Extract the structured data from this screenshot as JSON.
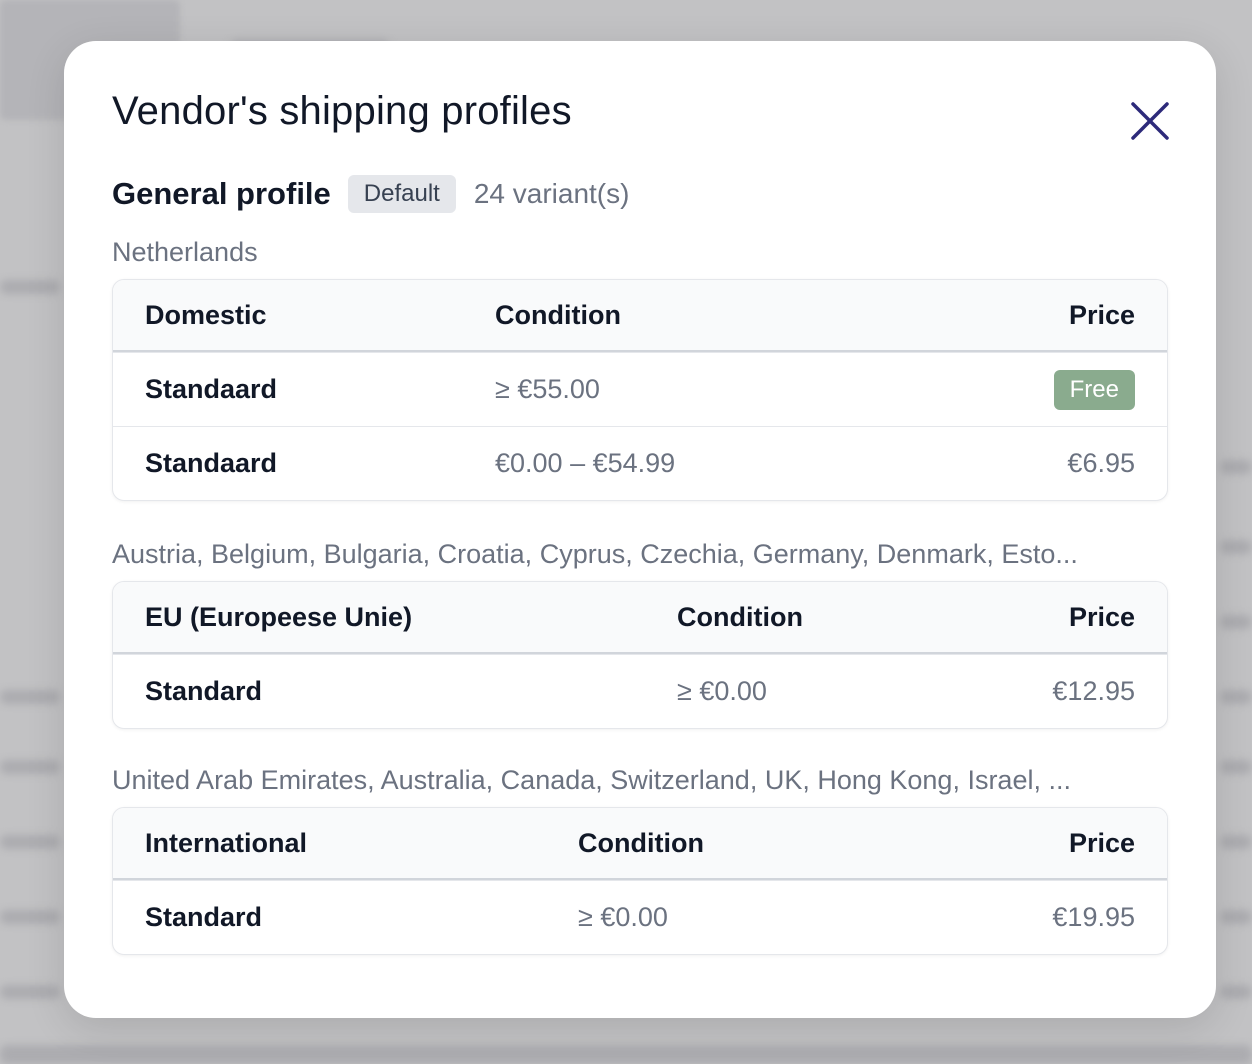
{
  "modal": {
    "title": "Vendor's shipping profiles",
    "close_icon": "close-icon"
  },
  "profile": {
    "name": "General profile",
    "badge": "Default",
    "variant_count": "24 variant(s)"
  },
  "groups": [
    {
      "label": "Netherlands",
      "columns": [
        "Domestic",
        "Condition",
        "Price"
      ],
      "rows": [
        {
          "name": "Standaard",
          "condition": "≥ €55.00",
          "price": "Free",
          "price_is_badge": true
        },
        {
          "name": "Standaard",
          "condition": "€0.00 – €54.99",
          "price": "€6.95"
        }
      ]
    },
    {
      "label": "Austria, Belgium, Bulgaria, Croatia, Cyprus, Czechia, Germany, Denmark, Esto...",
      "columns": [
        "EU (Europeese Unie)",
        "Condition",
        "Price"
      ],
      "rows": [
        {
          "name": "Standard",
          "condition": "≥ €0.00",
          "price": "€12.95"
        }
      ]
    },
    {
      "label": "United Arab Emirates, Australia, Canada, Switzerland, UK, Hong Kong, Israel, ...",
      "columns": [
        "International",
        "Condition",
        "Price"
      ],
      "rows": [
        {
          "name": "Standard",
          "condition": "≥ €0.00",
          "price": "€19.95"
        }
      ]
    }
  ],
  "colors": {
    "free_badge": "#8aab8e",
    "close_icon": "#2d2a7a"
  }
}
